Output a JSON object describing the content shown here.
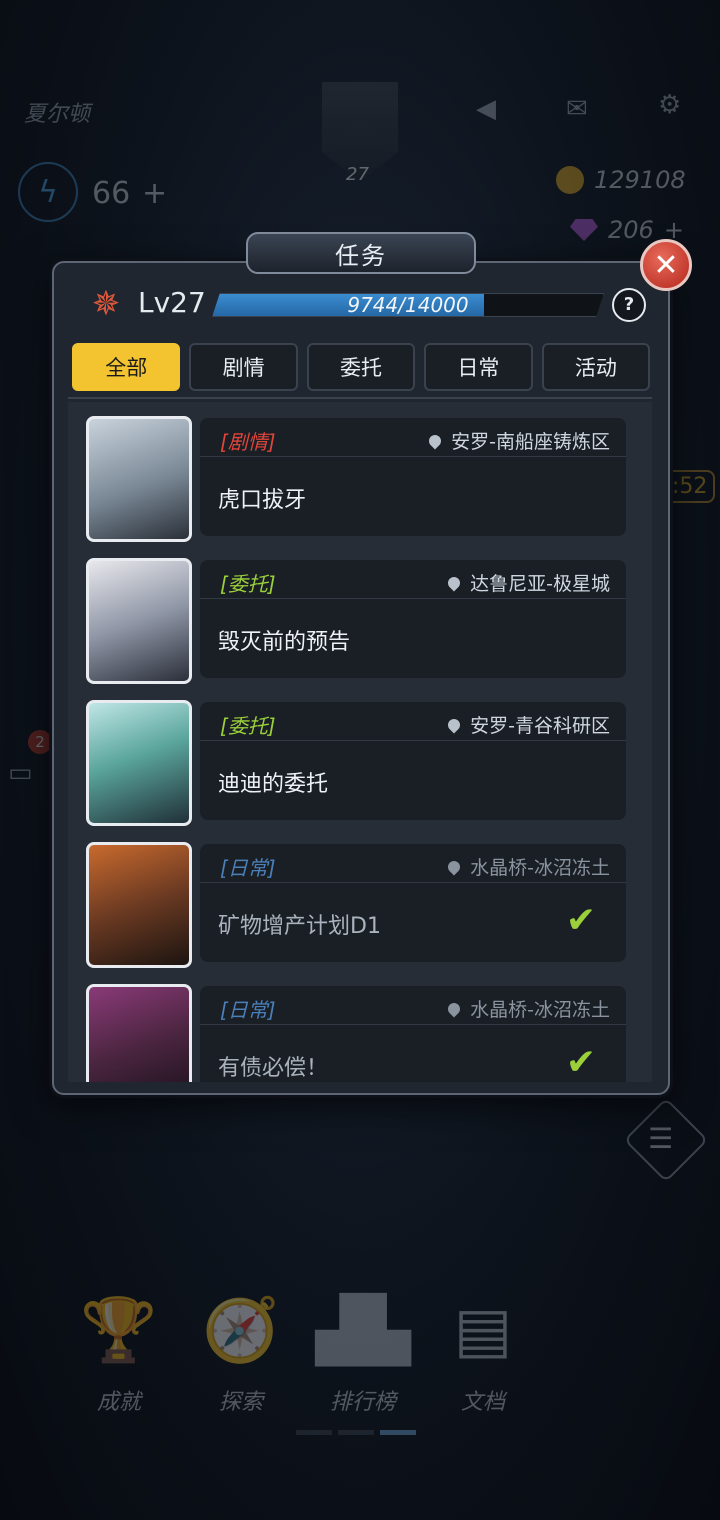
{
  "hud": {
    "city": "夏尔顿",
    "rank_level": "27",
    "energy": "66",
    "energy_plus": "+",
    "coins": "129108",
    "gems": "206",
    "gems_plus": "+",
    "event_timer": ":52",
    "chat_badge": "2"
  },
  "dialog": {
    "title": "任务",
    "close_label": "✕",
    "level": "Lv27",
    "xp_current": 9744,
    "xp_max": 14000,
    "xp_text": "9744/14000",
    "help_label": "?",
    "tabs": [
      {
        "label": "全部",
        "active": true
      },
      {
        "label": "剧情",
        "active": false
      },
      {
        "label": "委托",
        "active": false
      },
      {
        "label": "日常",
        "active": false
      },
      {
        "label": "活动",
        "active": false
      }
    ],
    "quests": [
      {
        "category": "[剧情]",
        "category_color": "#e0453a",
        "location": "安罗-南船座铸炼区",
        "name": "虎口拔牙",
        "completed": false,
        "portrait": "robot"
      },
      {
        "category": "[委托]",
        "category_color": "#9bd03a",
        "location": "达鲁尼亚-极星城",
        "name": "毁灭前的预告",
        "completed": false,
        "portrait": "old-man"
      },
      {
        "category": "[委托]",
        "category_color": "#9bd03a",
        "location": "安罗-青谷科研区",
        "name": "迪迪的委托",
        "completed": false,
        "portrait": "elf"
      },
      {
        "category": "[日常]",
        "category_color": "#4a7fb8",
        "location": "水晶桥-冰沼冻土",
        "name": "矿物增产计划D1",
        "completed": true,
        "portrait": "girl-goggles"
      },
      {
        "category": "[日常]",
        "category_color": "#4a7fb8",
        "location": "水晶桥-冰沼冻土",
        "name": "有债必偿！",
        "completed": true,
        "portrait": "glasses-man"
      }
    ]
  },
  "bottom_nav": [
    {
      "label": "成就",
      "icon": "trophy-icon",
      "glyph": "🏆"
    },
    {
      "label": "探索",
      "icon": "compass-icon",
      "glyph": "🧭"
    },
    {
      "label": "排行榜",
      "icon": "podium-icon",
      "glyph": "▟▙"
    },
    {
      "label": "文档",
      "icon": "document-icon",
      "glyph": "▤"
    }
  ],
  "colors": {
    "accent_yellow": "#f4c430",
    "xp_blue": "#3b8cd0",
    "close_red": "#c0392b",
    "check_green": "#9bd03a"
  }
}
